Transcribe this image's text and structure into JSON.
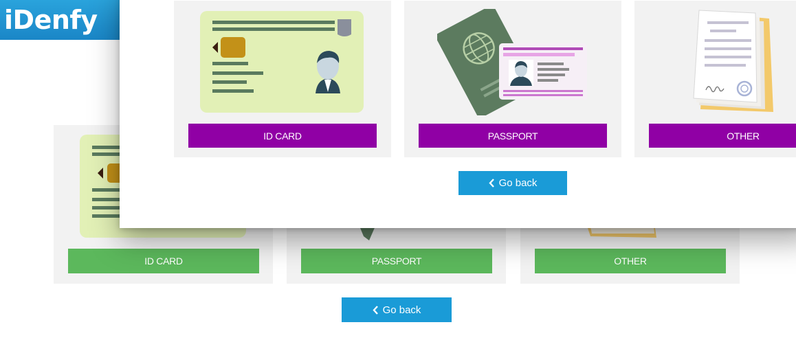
{
  "logo": {
    "text": "iDenfy"
  },
  "rear": {
    "cards": [
      {
        "label": "ID CARD"
      },
      {
        "label": "PASSPORT"
      },
      {
        "label": "OTHER"
      }
    ],
    "back_label": "Go back"
  },
  "front": {
    "cards": [
      {
        "label": "ID CARD"
      },
      {
        "label": "PASSPORT"
      },
      {
        "label": "OTHER"
      }
    ],
    "back_label": "Go back"
  },
  "colors": {
    "brand_blue": "#1a9bd7",
    "rear_button_green": "#5cb85c",
    "front_button_purple": "#9000a5",
    "card_bg": "#f2f2f2"
  }
}
